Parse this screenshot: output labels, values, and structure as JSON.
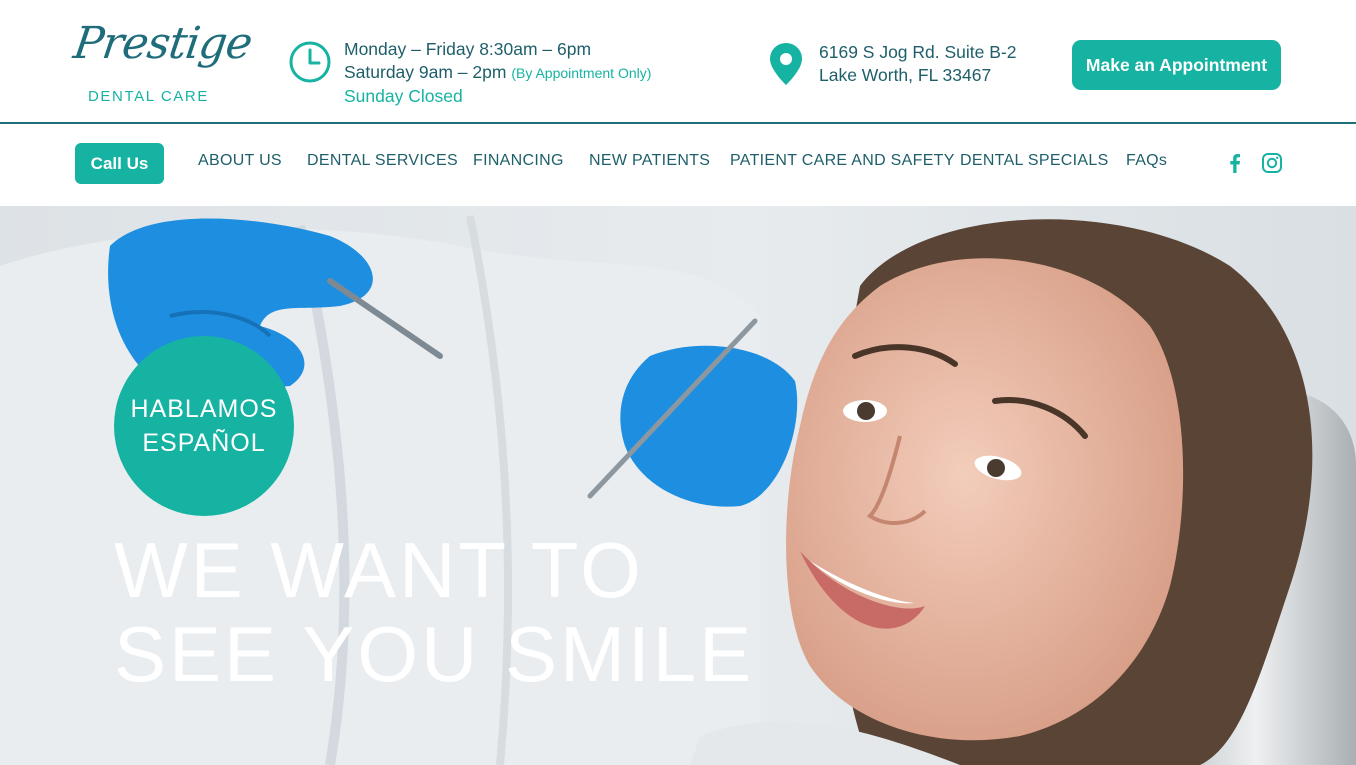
{
  "logo": {
    "script": "Prestige",
    "subtitle": "DENTAL CARE"
  },
  "hours": {
    "icon": "clock-icon",
    "line1": "Monday – Friday 8:30am – 6pm",
    "line2": "Saturday 9am – 2pm",
    "line2_note": "(By Appointment Only)",
    "line3": "Sunday Closed"
  },
  "address": {
    "icon": "map-pin-icon",
    "line1": "6169 S Jog Rd. Suite B-2",
    "line2": "Lake Worth, FL 33467"
  },
  "cta": {
    "appointment_label": "Make an Appointment",
    "call_label": "Call Us"
  },
  "nav": {
    "items": [
      {
        "label": "ABOUT US"
      },
      {
        "label": "DENTAL SERVICES"
      },
      {
        "label": "FINANCING"
      },
      {
        "label": "NEW PATIENTS"
      },
      {
        "label": "PATIENT CARE AND SAFETY"
      },
      {
        "label": "DENTAL SPECIALS"
      },
      {
        "label": "FAQs"
      }
    ],
    "social": [
      "facebook-icon",
      "instagram-icon"
    ]
  },
  "hero": {
    "badge_line1": "HABLAMOS",
    "badge_line2": "ESPAÑOL",
    "headline_line1": "WE WANT TO",
    "headline_line2": "SEE YOU SMILE"
  },
  "colors": {
    "accent": "#16b3a3",
    "text": "#1e5f6a",
    "glove": "#1e8fe0"
  }
}
